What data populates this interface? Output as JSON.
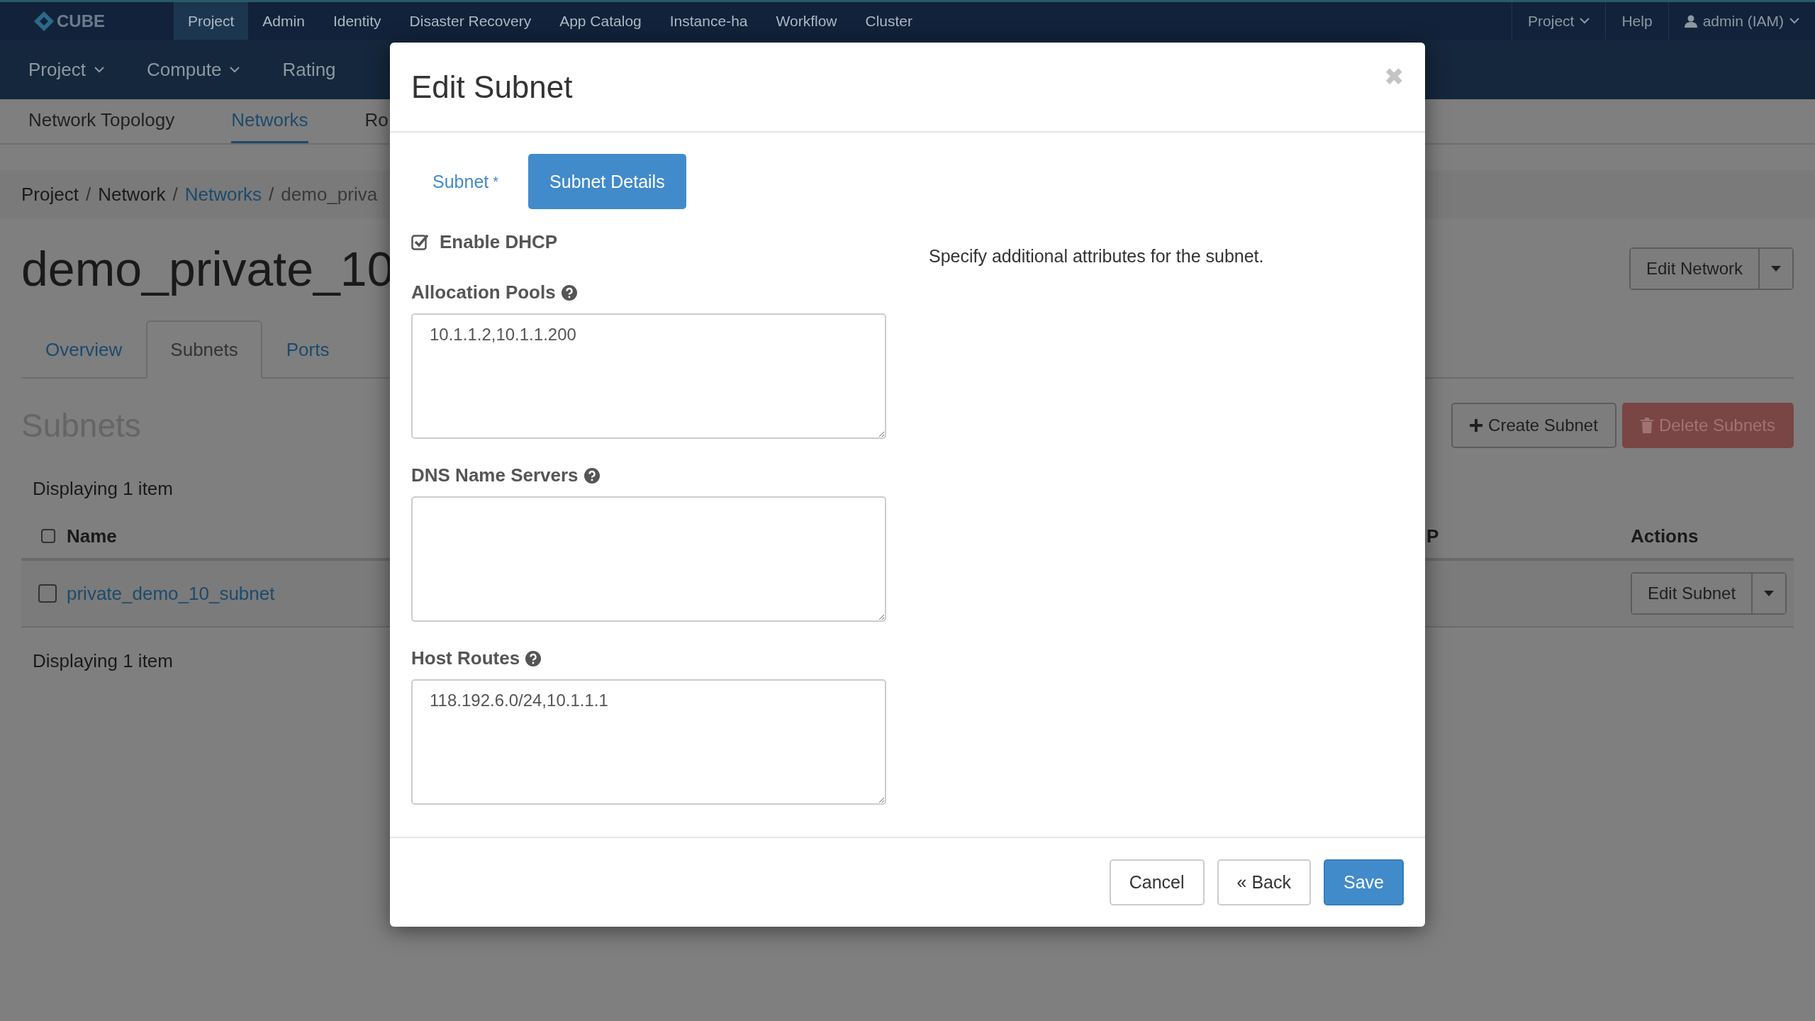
{
  "top_nav": {
    "logo": "CUBE",
    "items": [
      {
        "label": "Project",
        "selected": true
      },
      {
        "label": "Admin",
        "selected": false
      },
      {
        "label": "Identity",
        "selected": false
      },
      {
        "label": "Disaster Recovery",
        "selected": false
      },
      {
        "label": "App Catalog",
        "selected": false
      },
      {
        "label": "Instance-ha",
        "selected": false
      },
      {
        "label": "Workflow",
        "selected": false
      },
      {
        "label": "Cluster",
        "selected": false
      }
    ],
    "right": [
      {
        "label": "Project",
        "kind": "menu"
      },
      {
        "label": "Help",
        "kind": "link"
      },
      {
        "label": "admin (IAM)",
        "kind": "user"
      }
    ]
  },
  "main_nav": [
    {
      "label": "Project",
      "dropdown": true
    },
    {
      "label": "Compute",
      "dropdown": true
    },
    {
      "label": "Rating",
      "dropdown": false
    }
  ],
  "sub_nav": [
    {
      "label": "Network Topology",
      "selected": false
    },
    {
      "label": "Networks",
      "selected": true
    },
    {
      "label": "Ro",
      "selected": false
    }
  ],
  "breadcrumb": [
    {
      "label": "Project",
      "kind": "text"
    },
    {
      "label": "Network",
      "kind": "text",
      "separator": "/"
    },
    {
      "label": "Networks",
      "kind": "link",
      "separator": "/"
    },
    {
      "label": "demo_priva",
      "kind": "current",
      "separator": "/"
    }
  ],
  "page_title": "demo_private_10",
  "header_action": {
    "label": "Edit Network"
  },
  "tabs": [
    {
      "label": "Overview",
      "selected": false
    },
    {
      "label": "Subnets",
      "selected": true
    },
    {
      "label": "Ports",
      "selected": false
    }
  ],
  "section_title": "Subnets",
  "table_actions": [
    {
      "label": "Create Subnet",
      "kind": "create",
      "disabled": false
    },
    {
      "label": "Delete Subnets",
      "kind": "delete",
      "disabled": true
    }
  ],
  "table": {
    "count": "Displaying 1 item",
    "select_all": false,
    "columns": [
      {
        "label": "Name"
      },
      {
        "label": "P"
      },
      {
        "label": "Actions"
      }
    ],
    "rows": [
      {
        "selected": false,
        "name": "private_demo_10_subnet",
        "action": "Edit Subnet"
      }
    ],
    "footer": "Displaying 1 item"
  },
  "modal": {
    "title": "Edit Subnet",
    "close": "✖",
    "tabs": [
      {
        "label": "Subnet",
        "marker": "*",
        "selected": false
      },
      {
        "label": "Subnet Details",
        "selected": true
      }
    ],
    "dhcp": {
      "label": "Enable DHCP",
      "checked": true
    },
    "fields": [
      {
        "label": "Allocation Pools",
        "value": "10.1.1.2,10.1.1.200"
      },
      {
        "label": "DNS Name Servers"
      },
      {
        "label": "Host Routes",
        "value": "118.192.6.0/24,10.1.1.1"
      }
    ],
    "help": "Specify additional attributes for the subnet.",
    "buttons": [
      {
        "label": "Cancel",
        "kind": "default"
      },
      {
        "label": "« Back",
        "kind": "default"
      },
      {
        "label": "Save",
        "kind": "primary"
      }
    ]
  }
}
